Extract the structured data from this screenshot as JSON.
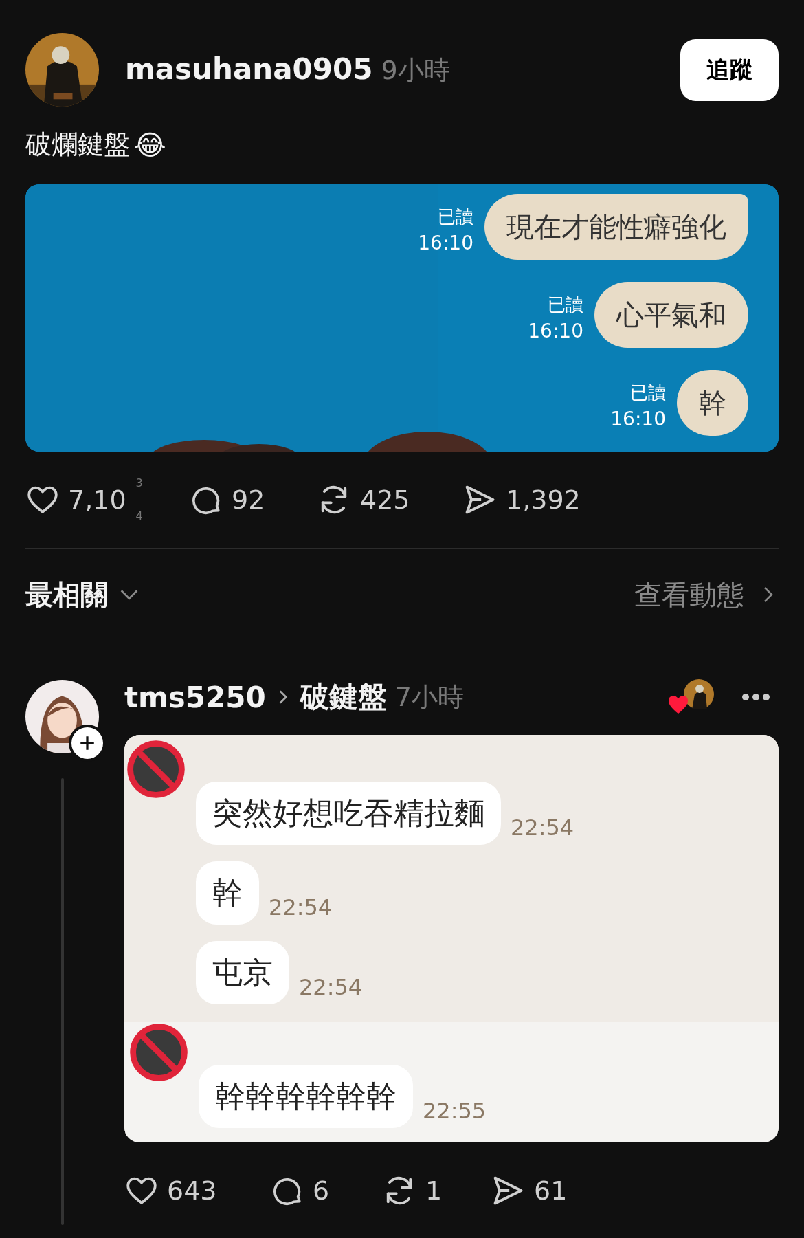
{
  "post": {
    "author": "masuhana0905",
    "time": "9小時",
    "follow_button": "追蹤",
    "text": "破爛鍵盤",
    "emoji": "😂",
    "image": {
      "messages": [
        {
          "read": "已讀",
          "time": "16:10",
          "text": "現在才能性癖強化",
          "tail": true
        },
        {
          "read": "已讀",
          "time": "16:10",
          "text": "心平氣和",
          "tail": false
        },
        {
          "read": "已讀",
          "time": "16:10",
          "text": "幹",
          "tail": false
        }
      ]
    },
    "actions": {
      "likes": "7,10",
      "likes_rolling": [
        "3",
        "4"
      ],
      "comments": "92",
      "reposts": "425",
      "shares": "1,392"
    }
  },
  "sort": {
    "label": "最相關",
    "activity_link": "查看動態"
  },
  "reply": {
    "author": "tms5250",
    "community": "破鍵盤",
    "time": "7小時",
    "liked_by_author": true,
    "image": {
      "groups": [
        {
          "messages": [
            {
              "text": "突然好想吃吞精拉麵",
              "time": "22:54"
            },
            {
              "text": "幹",
              "time": "22:54"
            },
            {
              "text": "屯京",
              "time": "22:54"
            }
          ]
        },
        {
          "messages": [
            {
              "text": "幹幹幹幹幹幹",
              "time": "22:55"
            }
          ]
        }
      ]
    },
    "actions": {
      "likes": "643",
      "comments": "6",
      "reposts": "1",
      "shares": "61"
    }
  }
}
